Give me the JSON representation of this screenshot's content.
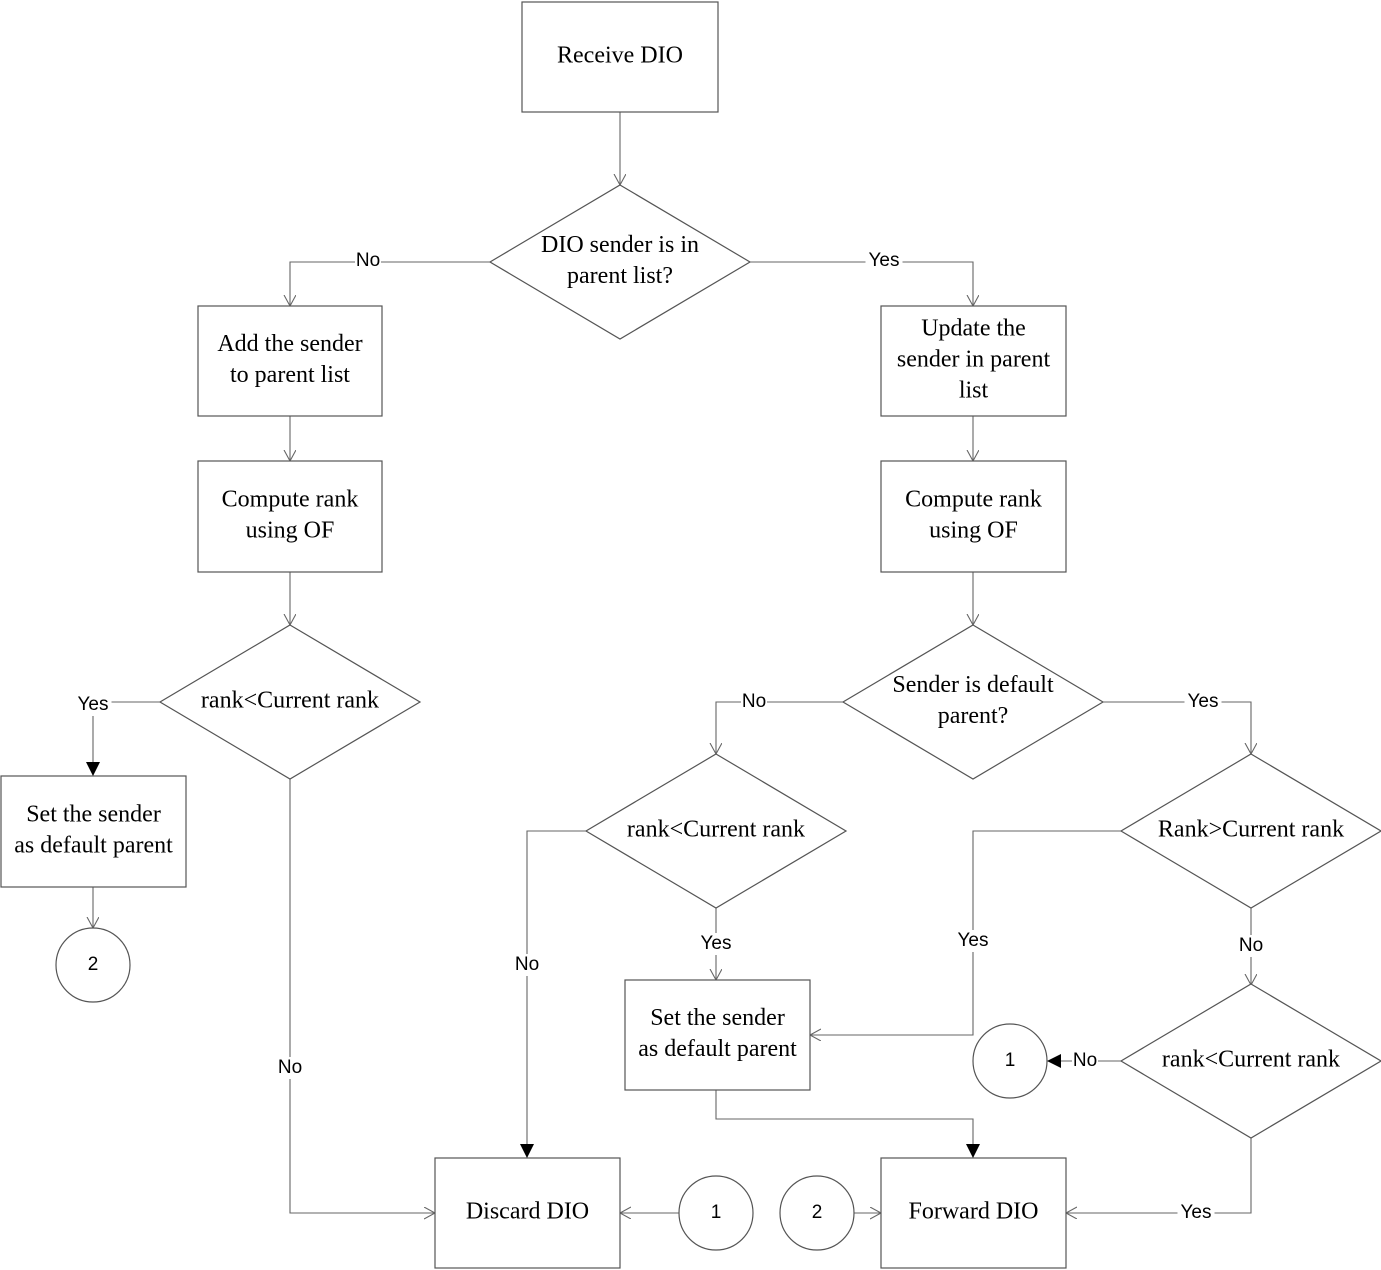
{
  "nodes": {
    "receive": [
      "Receive DIO"
    ],
    "in_parent": [
      "DIO sender is in",
      "parent list?"
    ],
    "add_sender": [
      "Add the sender",
      "to parent list"
    ],
    "compute_left": [
      "Compute rank",
      "using OF"
    ],
    "rank_left": [
      "rank<Current rank"
    ],
    "set_left": [
      "Set the sender",
      "as default parent"
    ],
    "update_sender": [
      "Update the",
      "sender in parent",
      "list"
    ],
    "compute_right": [
      "Compute rank",
      "using OF"
    ],
    "is_default": [
      "Sender is default",
      "parent?"
    ],
    "rank_mid": [
      "rank<Current rank"
    ],
    "set_mid": [
      "Set the sender",
      "as default parent"
    ],
    "rank_gt": [
      "Rank>Current rank"
    ],
    "rank_r3": [
      "rank<Current rank"
    ],
    "discard": [
      "Discard DIO"
    ],
    "forward": [
      "Forward DIO"
    ]
  },
  "connectors": {
    "c2_left": "2",
    "c1_right": "1",
    "c1_bottom": "1",
    "c2_bottom": "2"
  },
  "edge_labels": {
    "in_parent_no": "No",
    "in_parent_yes": "Yes",
    "rank_left_yes": "Yes",
    "rank_left_no": "No",
    "is_default_no": "No",
    "is_default_yes": "Yes",
    "rank_mid_no": "No",
    "rank_mid_yes": "Yes",
    "rank_gt_yes": "Yes",
    "rank_gt_no": "No",
    "rank_r3_no": "No",
    "rank_r3_yes": "Yes"
  }
}
